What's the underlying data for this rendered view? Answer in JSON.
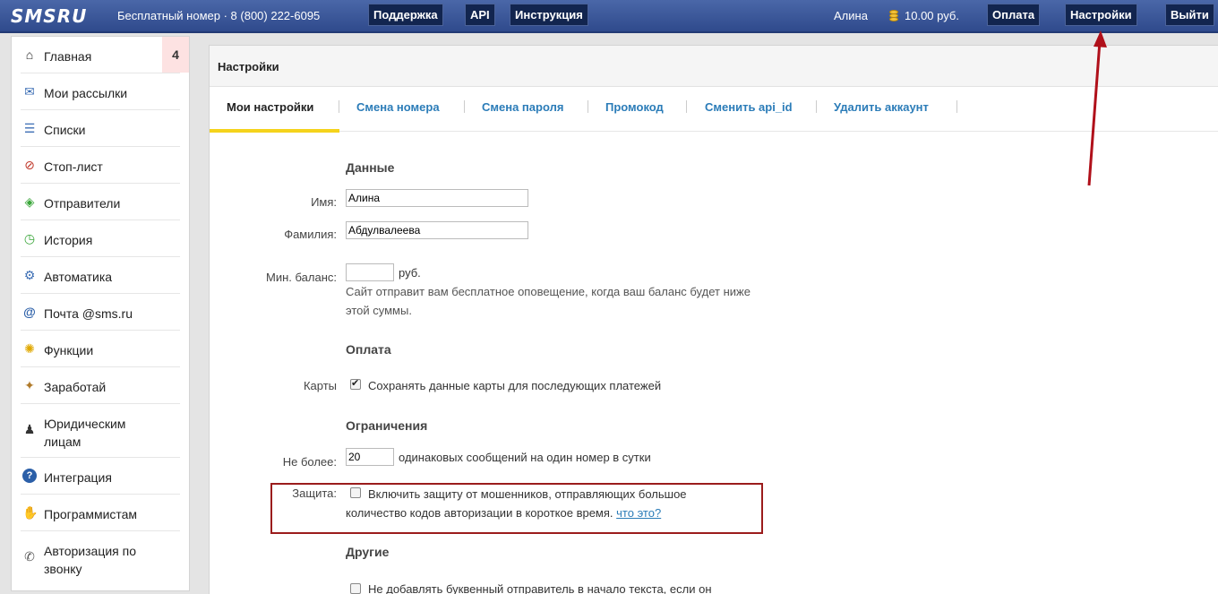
{
  "topbar": {
    "logo": "SMSRU",
    "free_number": "Бесплатный номер · 8 (800) 222-6095",
    "support": "Поддержка",
    "api": "API",
    "instruction": "Инструкция",
    "user": "Алина",
    "balance": "10.00 руб.",
    "pay": "Оплата",
    "settings": "Настройки",
    "logout": "Выйти"
  },
  "sidebar": {
    "badge": "4",
    "items": [
      {
        "label": "Главная",
        "icon": "home-icon"
      },
      {
        "label": "Мои рассылки",
        "icon": "mail-stack-icon"
      },
      {
        "label": "Списки",
        "icon": "list-icon"
      },
      {
        "label": "Стоп-лист",
        "icon": "stop-list-icon"
      },
      {
        "label": "Отправители",
        "icon": "tag-icon"
      },
      {
        "label": "История",
        "icon": "history-icon"
      },
      {
        "label": "Автоматика",
        "icon": "robot-icon"
      },
      {
        "label": "Почта @sms.ru",
        "icon": "at-icon"
      },
      {
        "label": "Функции",
        "icon": "lightbulb-icon"
      },
      {
        "label": "Заработай",
        "icon": "handshake-icon"
      },
      {
        "label": "Юридическим лицам",
        "icon": "businessman-icon"
      },
      {
        "label": "Интеграция",
        "icon": "help-icon"
      },
      {
        "label": "Программистам",
        "icon": "hand-icon"
      },
      {
        "label": "Авторизация по звонку",
        "icon": "phone-icon"
      }
    ]
  },
  "panel": {
    "title": "Настройки",
    "tabs": [
      "Мои настройки",
      "Смена номера",
      "Смена пароля",
      "Промокод",
      "Сменить api_id",
      "Удалить аккаунт"
    ]
  },
  "form": {
    "data_title": "Данные",
    "first_name_label": "Имя:",
    "first_name": "Алина",
    "last_name_label": "Фамилия:",
    "last_name": "Абдулвалеева",
    "min_balance_label": "Мин. баланс:",
    "min_balance": "",
    "currency": "руб.",
    "min_balance_hint": "Сайт отправит вам бесплатное оповещение, когда ваш баланс будет ниже этой суммы.",
    "payment_title": "Оплата",
    "cards_label": "Карты",
    "save_cards": "Сохранять данные карты для последующих платежей",
    "save_cards_checked": true,
    "limits_title": "Ограничения",
    "no_more_label": "Не более:",
    "no_more_value": "20",
    "no_more_text": "одинаковых сообщений на один номер в сутки",
    "protection_label": "Защита:",
    "protection_text": "Включить защиту от мошенников, отправляющих большое количество кодов авторизации в короткое время.",
    "protection_link": "что это?",
    "protection_checked": false,
    "other_title": "Другие",
    "other_text": "Не добавлять буквенный отправитель в начало текста, если он"
  }
}
